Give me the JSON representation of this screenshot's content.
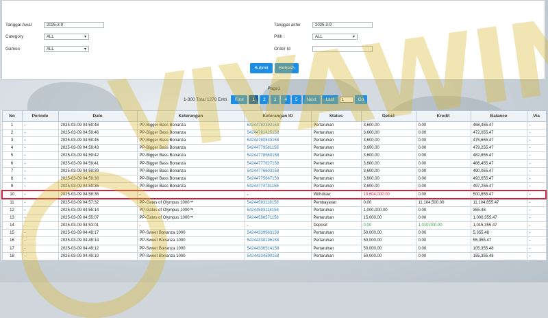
{
  "watermark": "VIVAWIN",
  "filters": {
    "start_date_label": "Tanggal Awal",
    "start_date_value": "2025-3-9",
    "end_date_label": "Tanggal akhir",
    "end_date_value": "2025-3-9",
    "category_label": "Category",
    "category_value": "ALL",
    "pilih_label": "Pilih :",
    "pilih_value": "ALL",
    "games_label": "Games",
    "games_value": "ALL",
    "order_id_label": "Order Id",
    "order_id_value": "",
    "submit_label": "Submit",
    "refresh_label": "Refresh"
  },
  "pager": {
    "title": "Page1",
    "info": "1-300 Total 1278 Entri",
    "first": "First",
    "pages": [
      "1",
      "2",
      "3",
      "4",
      "5"
    ],
    "next": "Next",
    "last": "Last",
    "input_value": "1",
    "go": "Go"
  },
  "table": {
    "headers": [
      "No",
      "Periode",
      "Date",
      "Keterangan",
      "Keterangan ID",
      "Status",
      "Debet",
      "Kredit",
      "Balance",
      "Via"
    ],
    "rows": [
      [
        "1",
        "-",
        "2025-03-09 04:59:48",
        "PP-Bigger Bass Bonanza",
        "54244782392158",
        "Pertaruhan",
        "3,600.00",
        "0.00",
        "468,455.47",
        "-"
      ],
      [
        "2",
        "-",
        "2025-03-09 04:59:46",
        "PP-Bigger Bass Bonanza",
        "54244781425158",
        "Pertaruhan",
        "3,600.00",
        "0.00",
        "472,055.47",
        "-"
      ],
      [
        "3",
        "-",
        "2025-03-09 04:59:45",
        "PP-Bigger Bass Bonanza",
        "54244780533158",
        "Pertaruhan",
        "3,600.00",
        "0.00",
        "475,655.47",
        "-"
      ],
      [
        "4",
        "-",
        "2025-03-09 04:59:43",
        "PP-Bigger Bass Bonanza",
        "54244779581158",
        "Pertaruhan",
        "3,600.00",
        "0.00",
        "479,255.47",
        "-"
      ],
      [
        "5",
        "-",
        "2025-03-09 04:59:42",
        "PP-Bigger Bass Bonanza",
        "54244778560158",
        "Pertaruhan",
        "3,600.00",
        "0.00",
        "482,855.47",
        "-"
      ],
      [
        "6",
        "-",
        "2025-03-09 04:59:41",
        "PP-Bigger Bass Bonanza",
        "54244777627158",
        "Pertaruhan",
        "3,600.00",
        "0.00",
        "486,455.47",
        "-"
      ],
      [
        "7",
        "-",
        "2025-03-09 04:59:39",
        "PP-Bigger Bass Bonanza",
        "54244776603158",
        "Pertaruhan",
        "3,600.00",
        "0.00",
        "490,055.47",
        "-"
      ],
      [
        "8",
        "-",
        "2025-03-09 04:59:38",
        "PP-Bigger Bass Bonanza",
        "54244775667158",
        "Pertaruhan",
        "3,600.00",
        "0.00",
        "493,655.47",
        "-"
      ],
      [
        "9",
        "-",
        "2025-03-09 04:59:36",
        "PP-Bigger Bass Bonanza",
        "54244774781158",
        "Pertaruhan",
        "3,600.00",
        "0.00",
        "497,255.47",
        "-"
      ],
      [
        "10",
        "-",
        "2025-03-09 04:58:36",
        "-",
        "-",
        "Withdraw",
        "10,604,000.00",
        "0.00",
        "500,855.47",
        "-"
      ],
      [
        "11",
        "-",
        "2025-03-09 04:57:32",
        "PP-Gates of Olympus 1000™",
        "54244593118158",
        "Pembayaran",
        "0.00",
        "11,104,500.00",
        "11,104,855.47",
        "-"
      ],
      [
        "12",
        "-",
        "2025-03-09 04:55:14",
        "PP-Gates of Olympus 1000™",
        "54244593118158",
        "Pertaruhan",
        "1,000,000.00",
        "0.00",
        "355.48",
        "-"
      ],
      [
        "13",
        "-",
        "2025-03-09 04:55:07",
        "PP-Gates of Olympus 1000™",
        "54244588571158",
        "Pertaruhan",
        "15,000.00",
        "0.00",
        "1,000,355.47",
        "-"
      ],
      [
        "14",
        "-",
        "2025-03-09 04:53:01",
        "-",
        "-",
        "Deposit",
        "0.00",
        "1,010,000.00",
        "1,015,355.47",
        "-"
      ],
      [
        "15",
        "-",
        "2025-03-09 04:49:17",
        "PP-Sweet Bonanza 1000",
        "54244339983158",
        "Pertaruhan",
        "50,000.00",
        "0.00",
        "5,355.48",
        "-"
      ],
      [
        "16",
        "-",
        "2025-03-09 04:49:14",
        "PP-Sweet Bonanza 1000",
        "54244338196158",
        "Pertaruhan",
        "50,000.00",
        "0.00",
        "55,355.47",
        "-"
      ],
      [
        "17",
        "-",
        "2025-03-09 04:49:12",
        "PP-Sweet Bonanza 1000",
        "54244336514158",
        "Pertaruhan",
        "50,000.00",
        "0.00",
        "105,355.48",
        "-"
      ],
      [
        "18",
        "-",
        "2025-03-09 04:49:10",
        "PP-Sweet Bonanza 1000",
        "54244334590158",
        "Pertaruhan",
        "50,000.00",
        "0.00",
        "155,355.48",
        "-"
      ]
    ],
    "highlight_row": 9,
    "colors": {
      "highlight": "#d0243a",
      "link": "#2a7ab8",
      "green": "#2e9b3a"
    }
  }
}
